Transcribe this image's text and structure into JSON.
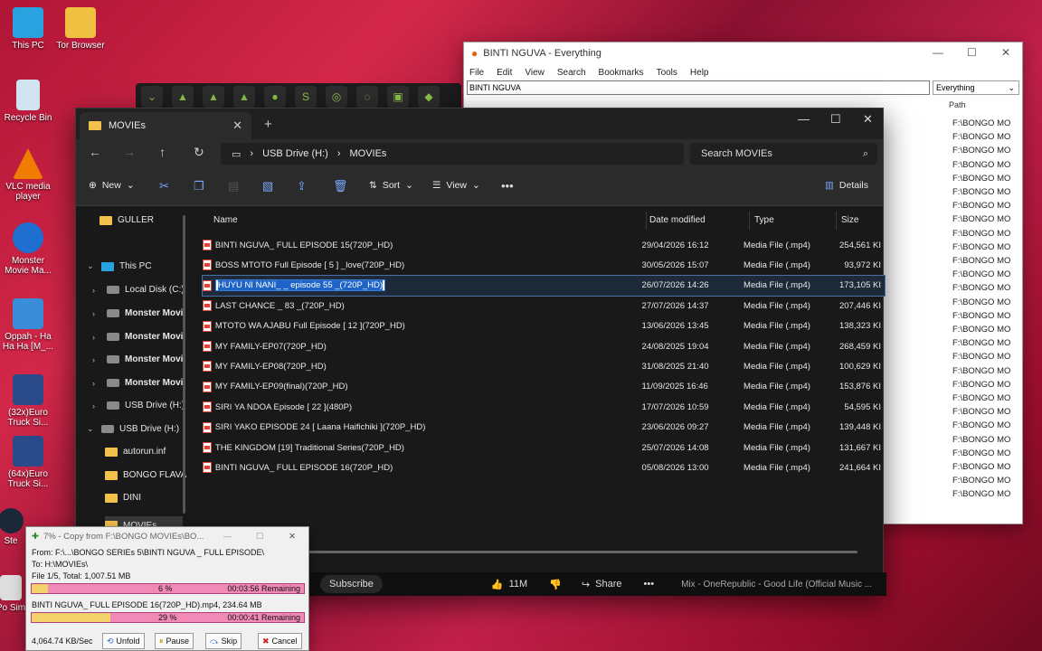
{
  "desktop": {
    "icons": [
      {
        "label": "This PC"
      },
      {
        "label": "Tor Browser"
      },
      {
        "label": "Recycle Bin"
      },
      {
        "label": "VLC media player"
      },
      {
        "label": "Monster Movie Ma..."
      },
      {
        "label": "Oppah - Ha Ha Ha [M_..."
      },
      {
        "label": "(32x)Euro Truck Si..."
      },
      {
        "label": "(64x)Euro Truck Si..."
      },
      {
        "label": "Ste"
      },
      {
        "label": "Po Sim"
      }
    ]
  },
  "everything": {
    "title": "BINTI NGUVA - Everything",
    "menu": [
      "File",
      "Edit",
      "View",
      "Search",
      "Bookmarks",
      "Tools",
      "Help"
    ],
    "search_value": "BINTI NGUVA",
    "filter": "Everything",
    "path_header": "Path",
    "path_value": "F:\\BONGO MO",
    "path_rows": 28
  },
  "explorer": {
    "tab_title": "MOVIEs",
    "breadcrumb": [
      "USB Drive (H:)",
      "MOVIEs"
    ],
    "search_placeholder": "Search MOVIEs",
    "commands": {
      "new": "New",
      "sort": "Sort",
      "view": "View",
      "details": "Details"
    },
    "tree": [
      {
        "label": "GULLER",
        "icon": "folder"
      },
      {
        "label": "This PC",
        "icon": "pc",
        "expanded": true
      },
      {
        "label": "Local Disk (C:)",
        "icon": "drive"
      },
      {
        "label": "Monster Movi",
        "icon": "drive"
      },
      {
        "label": "Monster Movi",
        "icon": "drive"
      },
      {
        "label": "Monster Movi",
        "icon": "drive"
      },
      {
        "label": "Monster Movi",
        "icon": "drive"
      },
      {
        "label": "USB Drive (H:)",
        "icon": "drive"
      },
      {
        "label": "USB Drive (H:)",
        "icon": "drive",
        "expanded": true
      },
      {
        "label": "autorun.inf",
        "icon": "folder"
      },
      {
        "label": "BONGO FLAVA",
        "icon": "folder"
      },
      {
        "label": "DINI",
        "icon": "folder"
      },
      {
        "label": "MOVIEs",
        "icon": "folder",
        "selected": true
      }
    ],
    "columns": [
      "Name",
      "Date modified",
      "Type",
      "Size"
    ],
    "files": [
      {
        "name": "BINTI NGUVA_ FULL EPISODE 15(720P_HD)",
        "date": "29/04/2026 16:12",
        "type": "Media File (.mp4)",
        "size": "254,561 KI"
      },
      {
        "name": "BOSS MTOTO Full Episode [ 5 ] _love(720P_HD)",
        "date": "30/05/2026 15:07",
        "type": "Media File (.mp4)",
        "size": "93,972 KI"
      },
      {
        "name": "HUYU NI NANI_ _ episode 55 _(720P_HD)",
        "date": "26/07/2026 14:26",
        "type": "Media File (.mp4)",
        "size": "173,105 KI",
        "renaming": true
      },
      {
        "name": "LAST CHANCE _ 83 _(720P_HD)",
        "date": "27/07/2026 14:37",
        "type": "Media File (.mp4)",
        "size": "207,446 KI"
      },
      {
        "name": "MTOTO WA AJABU Full Episode [ 12 ](720P_HD)",
        "date": "13/06/2026 13:45",
        "type": "Media File (.mp4)",
        "size": "138,323 KI"
      },
      {
        "name": "MY FAMILY-EP07(720P_HD)",
        "date": "24/08/2025 19:04",
        "type": "Media File (.mp4)",
        "size": "268,459 KI"
      },
      {
        "name": "MY FAMILY-EP08(720P_HD)",
        "date": "31/08/2025 21:40",
        "type": "Media File (.mp4)",
        "size": "100,629 KI"
      },
      {
        "name": "MY FAMILY-EP09(final)(720P_HD)",
        "date": "11/09/2025 16:46",
        "type": "Media File (.mp4)",
        "size": "153,876 KI"
      },
      {
        "name": "SIRI YA NDOA Episode [ 22 ](480P)",
        "date": "17/07/2026 10:59",
        "type": "Media File (.mp4)",
        "size": "54,595 KI"
      },
      {
        "name": "SIRI YAKO EPISODE 24 [ Laana Haifichiki ](720P_HD)",
        "date": "23/06/2026 09:27",
        "type": "Media File (.mp4)",
        "size": "139,448 KI"
      },
      {
        "name": "THE KINGDOM [19] Traditional Series(720P_HD)",
        "date": "25/07/2026 14:08",
        "type": "Media File (.mp4)",
        "size": "131,667 KI"
      },
      {
        "name": "BINTI NGUVA_ FULL EPISODE 16(720P_HD)",
        "date": "05/08/2026 13:00",
        "type": "Media File (.mp4)",
        "size": "241,664 KI"
      }
    ]
  },
  "video_overlay": {
    "subscribe": "Subscribe",
    "likes": "11M",
    "share": "Share",
    "mix_title": "Mix - OneRepublic - Good Life (Official Music ..."
  },
  "copy_dialog": {
    "title": "7% - Copy from F:\\BONGO MOVIEs\\BO...",
    "from": "From:  F:\\...\\BONGO SERIEs 5\\BINTI NGUVA _ FULL EPISODE\\",
    "to": "To:      H:\\MOVIEs\\",
    "total": "File 1/5, Total: 1,007.51 MB",
    "total_pct_text": "6 %",
    "total_progress": 0.06,
    "total_remaining": "00:03:56 Remaining",
    "current_file": "BINTI NGUVA_ FULL EPISODE 16(720P_HD).mp4, 234.64 MB",
    "file_pct_text": "29 %",
    "file_progress": 0.29,
    "file_remaining": "00:00:41 Remaining",
    "speed": "4,064.74 KB/Sec",
    "buttons": {
      "unfold": "Unfold",
      "pause": "Pause",
      "skip": "Skip",
      "cancel": "Cancel"
    }
  }
}
